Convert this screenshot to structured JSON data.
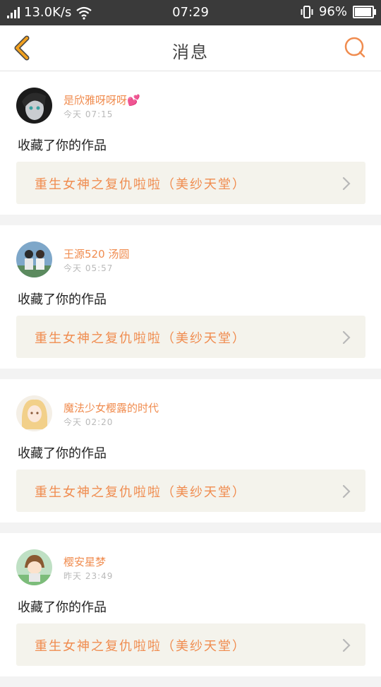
{
  "status_bar": {
    "network_speed": "13.0K/s",
    "time": "07:29",
    "battery_percent": "96%",
    "battery_level": 0.96
  },
  "nav": {
    "title": "消息",
    "accent_color": "#f0a020",
    "search_color": "#f08c4f"
  },
  "notifications": [
    {
      "user": "是欣雅呀呀呀💕",
      "time": "今天 07:15",
      "action": "收藏了你的作品",
      "work_title": "重生女神之复仇啦啦（美纱天堂）"
    },
    {
      "user": "王源520 汤圆",
      "time": "今天 05:57",
      "action": "收藏了你的作品",
      "work_title": "重生女神之复仇啦啦（美纱天堂）"
    },
    {
      "user": "魔法少女樱露的时代",
      "time": "今天 02:20",
      "action": "收藏了你的作品",
      "work_title": "重生女神之复仇啦啦（美纱天堂）"
    },
    {
      "user": "樱安星梦",
      "time": "昨天 23:49",
      "action": "收藏了你的作品",
      "work_title": "重生女神之复仇啦啦（美纱天堂）"
    }
  ]
}
